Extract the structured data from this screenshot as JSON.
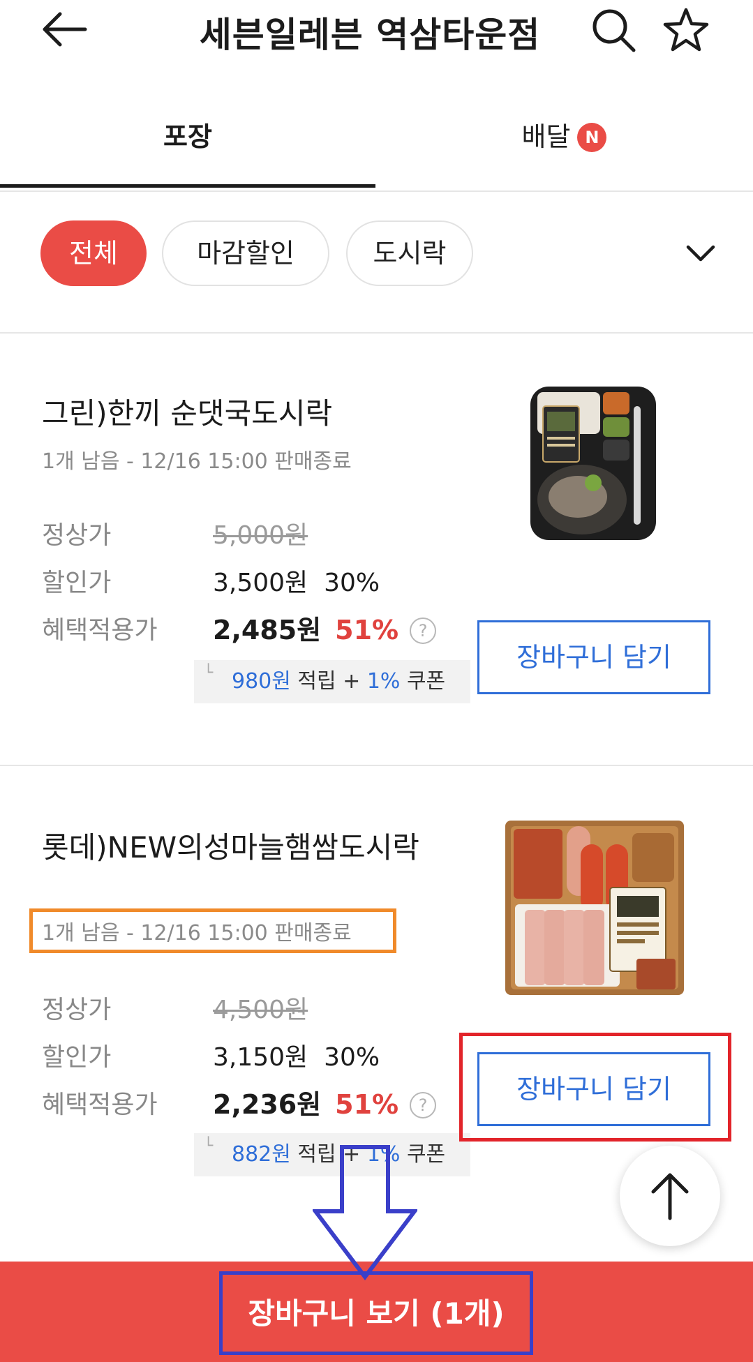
{
  "header": {
    "title": "세븐일레븐 역삼타운점",
    "back_icon": "arrow-left",
    "search_icon": "magnifier",
    "favorite_icon": "star-outline"
  },
  "tabs": [
    {
      "label": "포장",
      "active": true
    },
    {
      "label": "배달",
      "badge": "N",
      "active": false
    }
  ],
  "filters": {
    "chips": [
      "전체",
      "마감할인",
      "도시락"
    ],
    "active_index": 0,
    "expand_icon": "chevron-down"
  },
  "labels": {
    "regular_price": "정상가",
    "discount_price": "할인가",
    "benefit_price": "혜택적용가",
    "help": "?",
    "reward_corner": "└",
    "reward_mid": " 적립 + ",
    "reward_tail": " 쿠폰",
    "add_to_cart": "장바구니 담기"
  },
  "products": [
    {
      "name": "그린)한끼 순댓국도시락",
      "stock": "1개 남음 - 12/16 15:00 판매종료",
      "regular_price": "5,000원",
      "discount_price": "3,500원",
      "discount_rate": "30%",
      "benefit_price": "2,485원",
      "benefit_rate": "51%",
      "reward_points": "980원",
      "coupon_rate": "1%"
    },
    {
      "name": "롯데)NEW의성마늘햄쌈도시락",
      "stock": "1개 남음 - 12/16 15:00 판매종료",
      "regular_price": "4,500원",
      "discount_price": "3,150원",
      "discount_rate": "30%",
      "benefit_price": "2,236원",
      "benefit_rate": "51%",
      "reward_points": "882원",
      "coupon_rate": "1%"
    }
  ],
  "bottom_bar": {
    "view_cart_label": "장바구니 보기 (1개)"
  },
  "colors": {
    "accent": "#ea4c46",
    "link_blue": "#2f6ed8",
    "annotation_orange": "#f08a2a",
    "annotation_red": "#e2242a",
    "annotation_blue": "#3a3fc9"
  }
}
